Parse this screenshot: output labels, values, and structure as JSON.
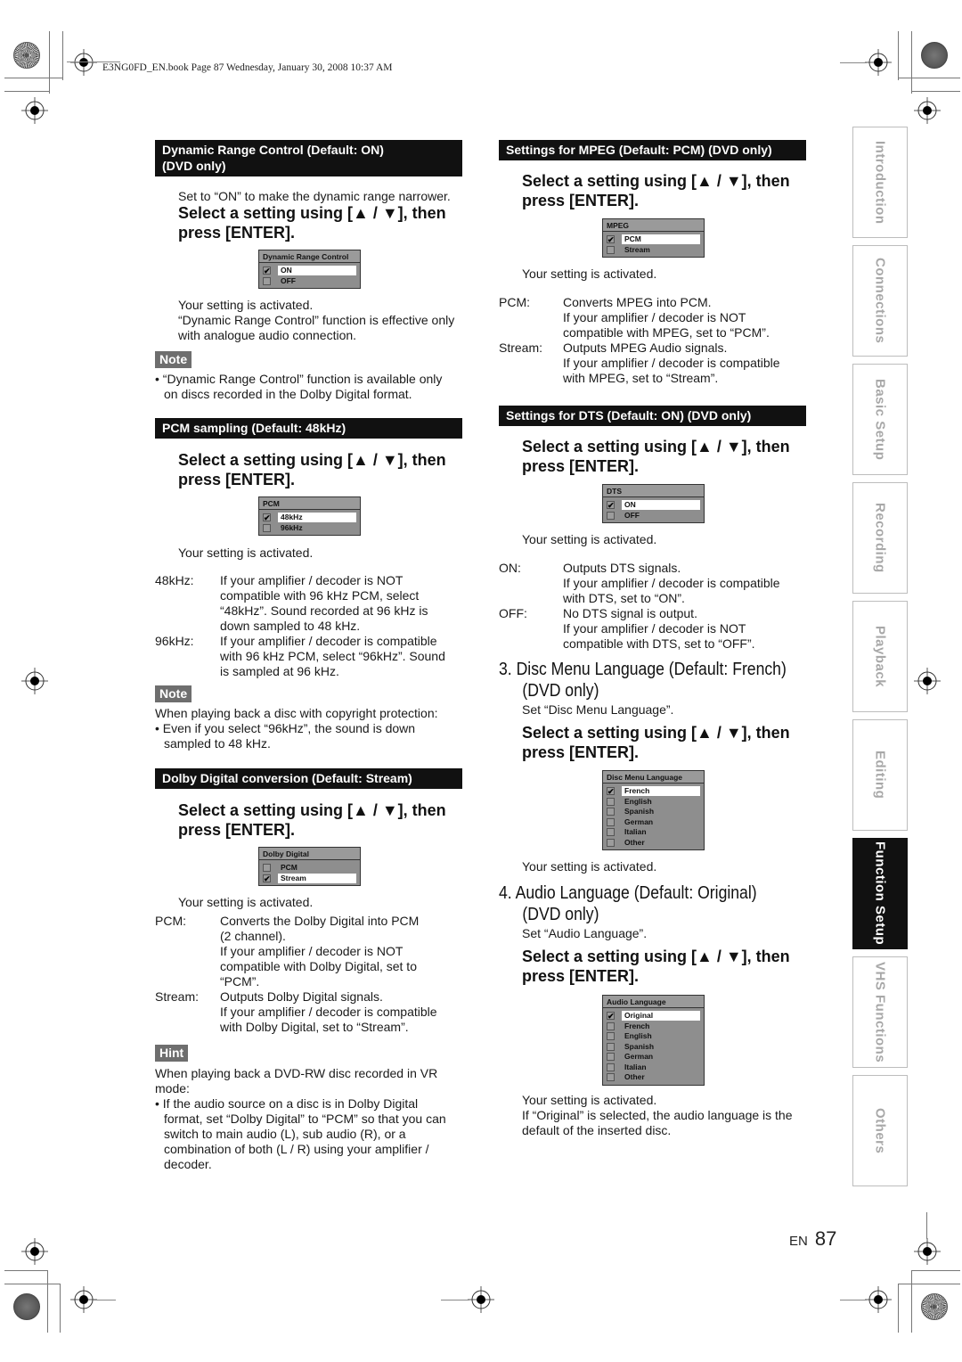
{
  "running_head": "E3NG0FD_EN.book  Page 87  Wednesday, January 30, 2008  10:37 AM",
  "common": {
    "instruction_line1": "Select a setting using [▲ / ▼], then",
    "instruction_line2": "press [ENTER].",
    "activated": "Your setting is activated."
  },
  "left": {
    "drc": {
      "bar_line1": "Dynamic Range Control (Default: ON)",
      "bar_line2": "(DVD only)",
      "intro": "Set to “ON” to make the dynamic range narrower.",
      "menu": {
        "title": "Dynamic Range Control",
        "options": [
          {
            "label": "ON",
            "checked": true
          },
          {
            "label": "OFF",
            "checked": false
          }
        ]
      },
      "after_line1": "“Dynamic Range Control” function is effective only",
      "after_line2": "with analogue audio connection.",
      "note_label": "Note",
      "note_line1": "“Dynamic Range Control” function is available only",
      "note_line2": "on discs recorded in the Dolby Digital format."
    },
    "pcm": {
      "bar": "PCM sampling (Default: 48kHz)",
      "menu": {
        "title": "PCM",
        "options": [
          {
            "label": "48kHz",
            "checked": true
          },
          {
            "label": "96kHz",
            "checked": false
          }
        ]
      },
      "defs": [
        {
          "term": "48kHz:",
          "lines": [
            "If your amplifier / decoder is NOT",
            "compatible with 96 kHz PCM, select",
            "“48kHz”. Sound recorded at 96 kHz is",
            "down sampled to 48 kHz."
          ]
        },
        {
          "term": "96kHz:",
          "lines": [
            "If your amplifier / decoder is compatible",
            "with 96 kHz PCM, select “96kHz”. Sound",
            "is sampled at 96 kHz."
          ]
        }
      ],
      "note_label": "Note",
      "note_intro": "When playing back a disc with copyright protection:",
      "note_line1": "Even if you select “96kHz”, the sound is down",
      "note_line2": "sampled to 48 kHz."
    },
    "dolby": {
      "bar": "Dolby Digital conversion (Default: Stream)",
      "menu": {
        "title": "Dolby Digital",
        "options": [
          {
            "label": "PCM",
            "checked": false
          },
          {
            "label": "Stream",
            "checked": true
          }
        ]
      },
      "defs": [
        {
          "term": "PCM:",
          "lines": [
            "Converts the Dolby Digital into PCM",
            "(2 channel).",
            "If your amplifier / decoder is NOT",
            "compatible with Dolby Digital, set to",
            "“PCM”."
          ]
        },
        {
          "term": "Stream:",
          "lines": [
            "Outputs Dolby Digital signals.",
            "If your amplifier / decoder is compatible",
            "with Dolby Digital, set to “Stream”."
          ]
        }
      ],
      "hint_label": "Hint",
      "hint_intro1": "When playing back a DVD-RW disc recorded in VR",
      "hint_intro2": "mode:",
      "hint_lines": [
        "If the audio source on a disc is in Dolby Digital",
        "format, set “Dolby Digital” to “PCM” so that you can",
        "switch to main audio (L), sub audio (R), or a",
        "combination of both (L / R) using your amplifier /",
        "decoder."
      ]
    }
  },
  "right": {
    "mpeg": {
      "bar": "Settings for MPEG (Default: PCM) (DVD only)",
      "menu": {
        "title": "MPEG",
        "options": [
          {
            "label": "PCM",
            "checked": true
          },
          {
            "label": "Stream",
            "checked": false
          }
        ]
      },
      "defs": [
        {
          "term": "PCM:",
          "lines": [
            "Converts MPEG into PCM.",
            "If your amplifier / decoder is NOT",
            "compatible with MPEG, set to “PCM”."
          ]
        },
        {
          "term": "Stream:",
          "lines": [
            "Outputs MPEG Audio signals.",
            "If your amplifier / decoder is compatible",
            "with MPEG, set to “Stream”."
          ]
        }
      ]
    },
    "dts": {
      "bar": "Settings for DTS (Default: ON) (DVD only)",
      "menu": {
        "title": "DTS",
        "options": [
          {
            "label": "ON",
            "checked": true
          },
          {
            "label": "OFF",
            "checked": false
          }
        ]
      },
      "defs": [
        {
          "term": "ON:",
          "lines": [
            "Outputs DTS signals.",
            "If your amplifier / decoder is compatible",
            "with DTS, set to “ON”."
          ]
        },
        {
          "term": "OFF:",
          "lines": [
            "No DTS signal is output.",
            "If your amplifier / decoder is NOT",
            "compatible with DTS, set to “OFF”."
          ]
        }
      ]
    },
    "disc_menu": {
      "heading_line1": "3.  Disc Menu Language (Default: French)",
      "heading_line2": "(DVD only)",
      "intro": "Set “Disc Menu Language”.",
      "menu": {
        "title": "Disc Menu Language",
        "options": [
          {
            "label": "French",
            "checked": true
          },
          {
            "label": "English",
            "checked": false
          },
          {
            "label": "Spanish",
            "checked": false
          },
          {
            "label": "German",
            "checked": false
          },
          {
            "label": "Italian",
            "checked": false
          },
          {
            "label": "Other",
            "checked": false
          }
        ]
      }
    },
    "audio_lang": {
      "heading_line1": "4.  Audio Language (Default: Original)",
      "heading_line2": "(DVD only)",
      "intro": "Set “Audio Language”.",
      "menu": {
        "title": "Audio Language",
        "options": [
          {
            "label": "Original",
            "checked": true
          },
          {
            "label": "French",
            "checked": false
          },
          {
            "label": "English",
            "checked": false
          },
          {
            "label": "Spanish",
            "checked": false
          },
          {
            "label": "German",
            "checked": false
          },
          {
            "label": "Italian",
            "checked": false
          },
          {
            "label": "Other",
            "checked": false
          }
        ]
      },
      "after_line1": "If “Original” is selected, the audio language is the",
      "after_line2": "default of the inserted disc."
    }
  },
  "side_tabs": [
    {
      "label": "Introduction",
      "active": false
    },
    {
      "label": "Connections",
      "active": false
    },
    {
      "label": "Basic Setup",
      "active": false
    },
    {
      "label": "Recording",
      "active": false
    },
    {
      "label": "Playback",
      "active": false
    },
    {
      "label": "Editing",
      "active": false
    },
    {
      "label": "Function Setup",
      "active": true
    },
    {
      "label": "VHS Functions",
      "active": false
    },
    {
      "label": "Others",
      "active": false
    }
  ],
  "footer": {
    "lang": "EN",
    "page": "87"
  }
}
